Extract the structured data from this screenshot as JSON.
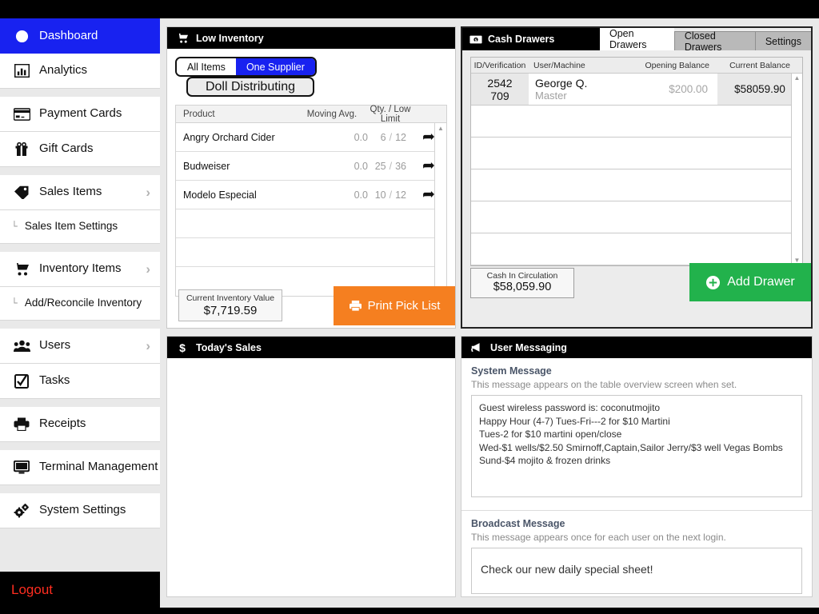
{
  "sidebar": {
    "items": [
      {
        "label": "Dashboard",
        "icon": "dashboard-icon",
        "active": true,
        "chevron": false,
        "sub": false
      },
      {
        "label": "Analytics",
        "icon": "bar-chart-icon",
        "active": false,
        "chevron": false,
        "sub": false
      },
      {
        "label": "Payment Cards",
        "icon": "credit-card-icon",
        "active": false,
        "chevron": false,
        "sub": false
      },
      {
        "label": "Gift Cards",
        "icon": "gift-icon",
        "active": false,
        "chevron": false,
        "sub": false
      },
      {
        "label": "Sales Items",
        "icon": "tag-icon",
        "active": false,
        "chevron": true,
        "sub": false
      },
      {
        "label": "Sales Item Settings",
        "icon": "",
        "active": false,
        "chevron": false,
        "sub": true
      },
      {
        "label": "Inventory Items",
        "icon": "shopping-cart-icon",
        "active": false,
        "chevron": true,
        "sub": false
      },
      {
        "label": "Add/Reconcile Inventory",
        "icon": "",
        "active": false,
        "chevron": false,
        "sub": true
      },
      {
        "label": "Users",
        "icon": "users-icon",
        "active": false,
        "chevron": true,
        "sub": false
      },
      {
        "label": "Tasks",
        "icon": "checkbox-icon",
        "active": false,
        "chevron": false,
        "sub": false
      },
      {
        "label": "Receipts",
        "icon": "printer-icon",
        "active": false,
        "chevron": false,
        "sub": false
      },
      {
        "label": "Terminal Management",
        "icon": "monitor-icon",
        "active": false,
        "chevron": false,
        "sub": false
      },
      {
        "label": "System Settings",
        "icon": "gears-icon",
        "active": false,
        "chevron": false,
        "sub": false
      }
    ],
    "logout_label": "Logout",
    "branch_glyph": "└",
    "chevron_glyph": "›",
    "active_color": "#1822f0",
    "logout_color": "#ff2d20"
  },
  "low_inventory": {
    "title": "Low Inventory",
    "icon": "shopping-cart-icon",
    "filters": [
      {
        "label": "All Items",
        "selected": false
      },
      {
        "label": "One Supplier",
        "selected": true
      }
    ],
    "supplier_button": "Doll Distributing",
    "columns": [
      "Product",
      "Moving Avg.",
      "Qty. / Low Limit"
    ],
    "rows": [
      {
        "product": "Angry Orchard Cider",
        "moving_avg": "0.0",
        "qty": "6",
        "low_limit": "12",
        "action_icon": "share-arrow-icon"
      },
      {
        "product": "Budweiser",
        "moving_avg": "0.0",
        "qty": "25",
        "low_limit": "36",
        "action_icon": "share-arrow-icon"
      },
      {
        "product": "Modelo Especial",
        "moving_avg": "0.0",
        "qty": "10",
        "low_limit": "12",
        "action_icon": "share-arrow-icon"
      }
    ],
    "empty_rows": 3,
    "value_label": "Current Inventory Value",
    "value_amount": "$7,719.59",
    "print_button": "Print Pick List",
    "print_icon": "printer-icon",
    "print_color": "#f57f20",
    "separator": "/"
  },
  "todays_sales": {
    "title": "Today's Sales",
    "icon": "dollar-icon",
    "icon_glyph": "$"
  },
  "cash_drawers": {
    "title": "Cash Drawers",
    "icon": "money-bill-icon",
    "tabs": [
      {
        "label": "Open Drawers",
        "active": true
      },
      {
        "label": "Closed Drawers",
        "active": false
      },
      {
        "label": "Settings",
        "active": false
      }
    ],
    "columns": [
      "ID/Verification",
      "User/Machine",
      "Opening Balance",
      "Current Balance"
    ],
    "rows": [
      {
        "id": "2542",
        "verification": "709",
        "user": "George Q.",
        "machine": "Master",
        "opening_balance": "$200.00",
        "current_balance": "$58059.90"
      }
    ],
    "empty_rows": 5,
    "value_label": "Cash In Circulation",
    "value_amount": "$58,059.90",
    "add_button": "Add Drawer",
    "add_icon": "plus-circle-icon",
    "add_color": "#22b24c"
  },
  "user_messaging": {
    "title": "User Messaging",
    "icon": "megaphone-icon",
    "system": {
      "heading": "System Message",
      "description": "This message appears on the table overview screen when set.",
      "value": "Guest wireless password is: coconutmojito\nHappy Hour (4-7) Tues-Fri---2 for $10 Martini\nTues-2 for $10 martini open/close\nWed-$1 wells/$2.50 Smirnoff,Captain,Sailor Jerry/$3 well Vegas Bombs\nSund-$4 mojito & frozen drinks"
    },
    "broadcast": {
      "heading": "Broadcast Message",
      "description": "This message appears once for each user on the next login.",
      "value": "Check our new daily special sheet!"
    }
  }
}
